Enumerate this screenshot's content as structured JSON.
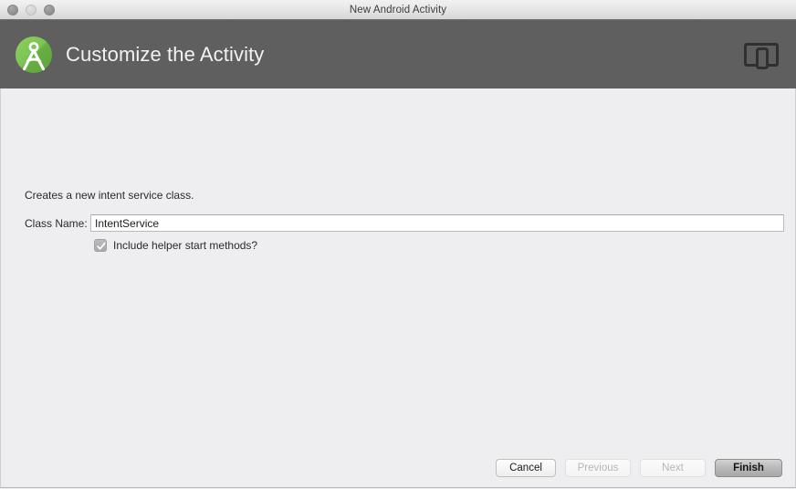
{
  "window": {
    "title": "New Android Activity",
    "traffic_lights": [
      {
        "name": "close",
        "label": "Close"
      },
      {
        "name": "minimize",
        "label": "Minimize"
      },
      {
        "name": "zoom",
        "label": "Zoom"
      }
    ]
  },
  "header": {
    "title": "Customize the Activity",
    "logo_icon": "android-studio-logo-icon",
    "right_icon": "device-preview-icon",
    "background_color": "#5f5f5f",
    "logo_green": "#78c257",
    "title_color": "#f2f2f2"
  },
  "form": {
    "description": "Creates a new intent service class.",
    "class_name": {
      "label": "Class Name:",
      "value": "IntentService",
      "placeholder": ""
    },
    "helper_methods": {
      "label": "Include helper start methods?",
      "checked": true,
      "check_icon": "checkmark-icon"
    }
  },
  "footer": {
    "buttons": [
      {
        "label": "Cancel",
        "state": "enabled"
      },
      {
        "label": "Previous",
        "state": "disabled"
      },
      {
        "label": "Next",
        "state": "disabled"
      },
      {
        "label": "Finish",
        "state": "default"
      }
    ]
  }
}
